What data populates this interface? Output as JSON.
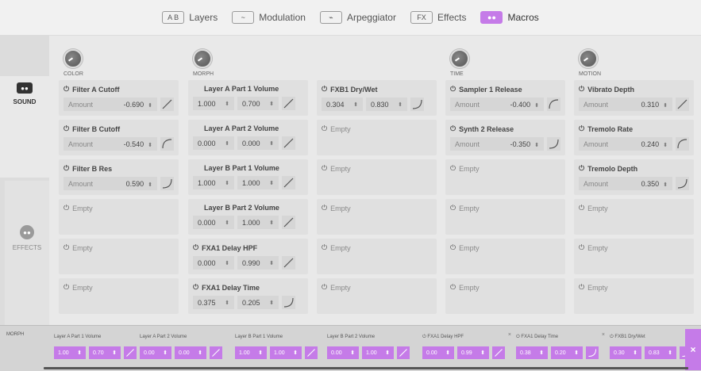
{
  "nav": {
    "tabs": [
      {
        "label": "Layers",
        "icon": "A B",
        "active": false
      },
      {
        "label": "Modulation",
        "icon": "~",
        "active": false
      },
      {
        "label": "Arpeggiator",
        "icon": "⌁",
        "active": false
      },
      {
        "label": "Effects",
        "icon": "FX",
        "active": false
      },
      {
        "label": "Macros",
        "icon": "●●",
        "active": true
      }
    ]
  },
  "side": {
    "sound": "SOUND",
    "effects": "EFFECTS"
  },
  "accent": "#c57be8",
  "macros": [
    {
      "label": "COLOR",
      "slots": [
        {
          "title": "Filter A Cutoff",
          "type": "amount",
          "amount_label": "Amount",
          "value": "-0.690",
          "curve": "linear"
        },
        {
          "title": "Filter B Cutoff",
          "type": "amount",
          "amount_label": "Amount",
          "value": "-0.540",
          "curve": "log"
        },
        {
          "title": "Filter B Res",
          "type": "amount",
          "amount_label": "Amount",
          "value": "0.590",
          "curve": "exp"
        },
        {
          "title": "Empty",
          "type": "empty"
        },
        {
          "title": "Empty",
          "type": "empty"
        },
        {
          "title": "Empty",
          "type": "empty"
        }
      ]
    },
    {
      "label": "MORPH",
      "slots": [
        {
          "title": "Layer A Part 1 Volume",
          "type": "range",
          "min": "1.000",
          "max": "0.700",
          "curve": "linear"
        },
        {
          "title": "Layer A Part 2 Volume",
          "type": "range",
          "min": "0.000",
          "max": "0.000",
          "curve": "linear"
        },
        {
          "title": "Layer B Part 1 Volume",
          "type": "range",
          "min": "1.000",
          "max": "1.000",
          "curve": "linear"
        },
        {
          "title": "Layer B Part 2 Volume",
          "type": "range",
          "min": "0.000",
          "max": "1.000",
          "curve": "linear"
        },
        {
          "title": "FXA1 Delay HPF",
          "type": "range",
          "min": "0.000",
          "max": "0.990",
          "curve": "linear",
          "power": true
        },
        {
          "title": "FXA1 Delay Time",
          "type": "range",
          "min": "0.375",
          "max": "0.205",
          "curve": "exp",
          "power": true
        }
      ]
    },
    {
      "label": "",
      "slots": [
        {
          "title": "FXB1 Dry/Wet",
          "type": "range",
          "min": "0.304",
          "max": "0.830",
          "curve": "exp",
          "power": true
        },
        {
          "title": "Empty",
          "type": "empty"
        },
        {
          "title": "Empty",
          "type": "empty"
        },
        {
          "title": "Empty",
          "type": "empty"
        },
        {
          "title": "Empty",
          "type": "empty"
        },
        {
          "title": "Empty",
          "type": "empty"
        }
      ]
    },
    {
      "label": "TIME",
      "slots": [
        {
          "title": "Sampler 1 Release",
          "type": "amount",
          "amount_label": "Amount",
          "value": "-0.400",
          "curve": "log"
        },
        {
          "title": "Synth 2 Release",
          "type": "amount",
          "amount_label": "Amount",
          "value": "-0.350",
          "curve": "exp"
        },
        {
          "title": "Empty",
          "type": "empty"
        },
        {
          "title": "Empty",
          "type": "empty"
        },
        {
          "title": "Empty",
          "type": "empty"
        },
        {
          "title": "Empty",
          "type": "empty"
        }
      ]
    },
    {
      "label": "MOTION",
      "slots": [
        {
          "title": "Vibrato Depth",
          "type": "amount",
          "amount_label": "Amount",
          "value": "0.310",
          "curve": "linear"
        },
        {
          "title": "Tremolo Rate",
          "type": "amount",
          "amount_label": "Amount",
          "value": "0.240",
          "curve": "log"
        },
        {
          "title": "Tremolo Depth",
          "type": "amount",
          "amount_label": "Amount",
          "value": "0.350",
          "curve": "exp"
        },
        {
          "title": "Empty",
          "type": "empty"
        },
        {
          "title": "Empty",
          "type": "empty"
        },
        {
          "title": "Empty",
          "type": "empty"
        }
      ]
    }
  ],
  "bottom": {
    "label": "MORPH",
    "slots": [
      {
        "title": "Layer A Part 1 Volume",
        "min": "1.00",
        "max": "0.70",
        "curve": "linear"
      },
      {
        "title": "Layer A Part 2 Volume",
        "min": "0.00",
        "max": "0.00",
        "curve": "linear"
      },
      {
        "title": "Layer B Part 1 Volume",
        "min": "1.00",
        "max": "1.00",
        "curve": "linear"
      },
      {
        "title": "Layer B Part 2 Volume",
        "min": "0.00",
        "max": "1.00",
        "curve": "linear"
      },
      {
        "title": "FXA1 Delay HPF",
        "min": "0.00",
        "max": "0.99",
        "curve": "linear",
        "power": true,
        "close": "×"
      },
      {
        "title": "FXA1 Delay Time",
        "min": "0.38",
        "max": "0.20",
        "curve": "exp",
        "power": true,
        "close": "×"
      },
      {
        "title": "FXB1 Dry/Wet",
        "min": "0.30",
        "max": "0.83",
        "curve": "exp",
        "power": true
      }
    ],
    "close_label": "×"
  }
}
